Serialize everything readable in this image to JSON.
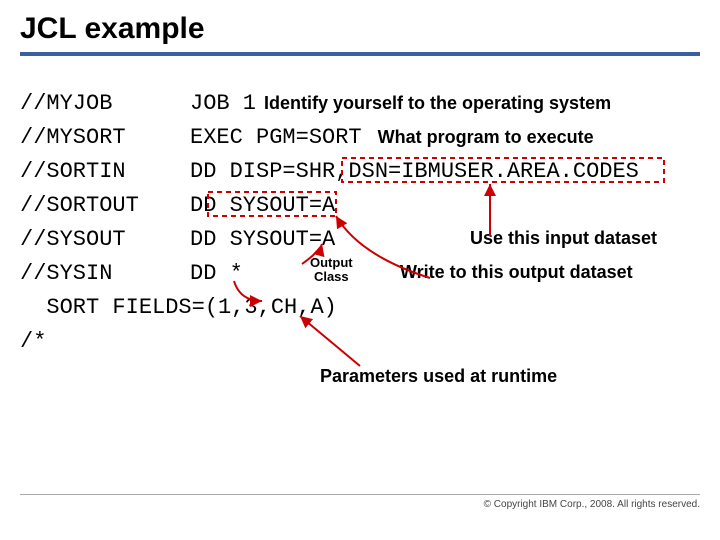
{
  "title": "JCL example",
  "code": {
    "l1_left": "//MYJOB",
    "l1_right": "JOB 1",
    "l2_left": "//MYSORT",
    "l2_right": "EXEC PGM=SORT",
    "l3_left": "//SORTIN",
    "l3_right": "DD DISP=SHR,DSN=IBMUSER.AREA.CODES",
    "l4_left": "//SORTOUT",
    "l4_right": "DD SYSOUT=A",
    "l5_left": "//SYSOUT",
    "l5_right": "DD SYSOUT=A",
    "l6_left": "//SYSIN",
    "l6_right": "DD *",
    "l7": "  SORT FIELDS=(1,3,CH,A)",
    "l8": "/*"
  },
  "annotations": {
    "identify": "Identify yourself to the operating system",
    "program": "What program to execute",
    "input_ds": "Use this input dataset",
    "output_ds": "Write to this output dataset",
    "output_class_l1": "Output",
    "output_class_l2": "Class",
    "runtime": "Parameters used at runtime"
  },
  "footer": "© Copyright IBM Corp., 2008. All rights reserved."
}
